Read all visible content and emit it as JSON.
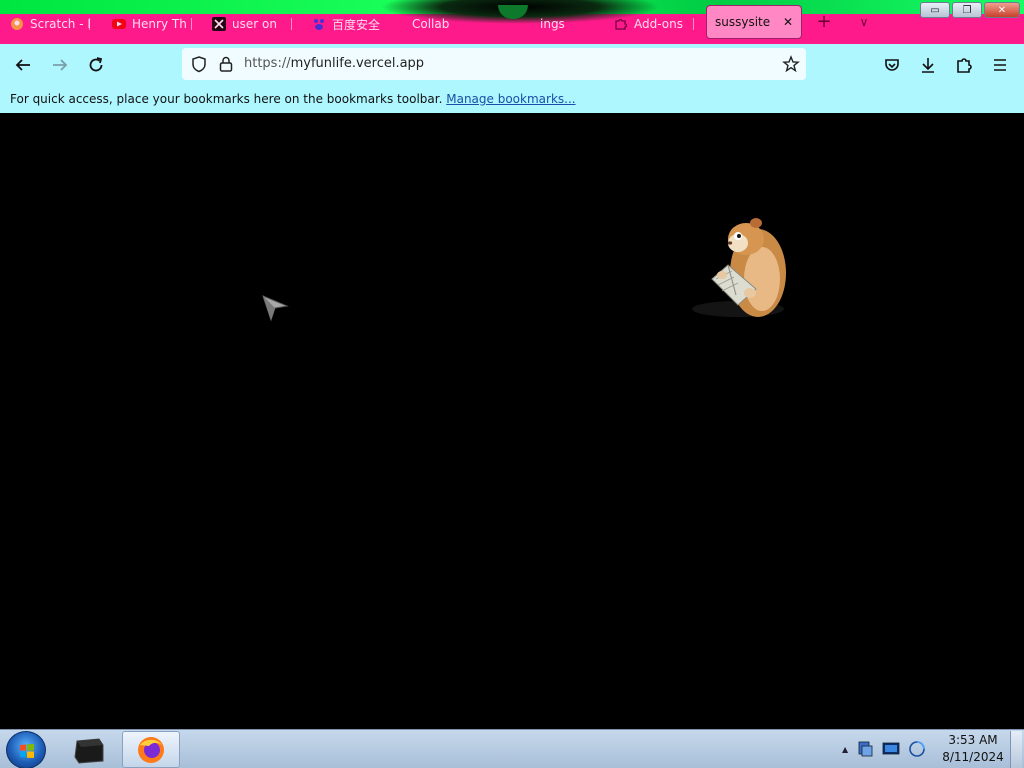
{
  "tabs": [
    {
      "label": "Scratch - I",
      "icon": "scratch-icon"
    },
    {
      "label": "Henry Th",
      "icon": "youtube-icon"
    },
    {
      "label": "user on",
      "icon": "x-icon"
    },
    {
      "label": "百度安全",
      "icon": "baidu-icon"
    },
    {
      "label": "Collab",
      "icon": "collab-icon"
    },
    {
      "label": "ings",
      "icon": "settings-icon"
    },
    {
      "label": "Add-ons",
      "icon": "addons-icon"
    }
  ],
  "active_tab": {
    "label": "sussysite",
    "close": "✕"
  },
  "new_tab": "+",
  "tab_list": "∨",
  "window_buttons": {
    "minimize": "▭",
    "restore": "❐",
    "close": "✕"
  },
  "address_bar": {
    "protocol": "https://",
    "domain": "myfunlife.vercel.app"
  },
  "bookmarks_bar": {
    "message": "For quick access, place your bookmarks here on the bookmarks toolbar.",
    "link": "Manage bookmarks..."
  },
  "taskbar": {
    "pinned": [
      {
        "name": "terminal-icon"
      },
      {
        "name": "firefox-icon",
        "active": true
      }
    ],
    "tray_arrow": "▲",
    "clock_time": "3:53 AM",
    "clock_date": "8/11/2024"
  },
  "colors": {
    "tabstrip": "#ff1a8c",
    "glow": "#00e640",
    "toolbar": "#aef7ff",
    "content_bg": "#000000"
  }
}
